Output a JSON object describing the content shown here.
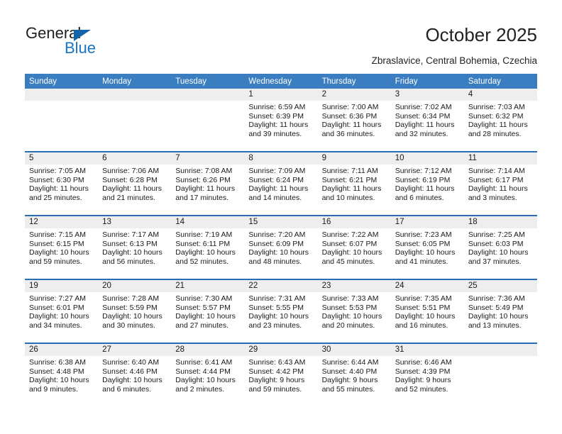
{
  "brand": {
    "name_top": "General",
    "name_bottom": "Blue",
    "accent_color": "#1874c4"
  },
  "header": {
    "title": "October 2025",
    "subtitle": "Zbraslavice, Central Bohemia, Czechia"
  },
  "colors": {
    "header_row_bg": "#3a7dc0",
    "header_row_text": "#ffffff",
    "row_divider": "#2a6db5",
    "date_strip_bg": "#eeeeee"
  },
  "labels": {
    "sunrise_prefix": "Sunrise:",
    "sunset_prefix": "Sunset:",
    "daylight_prefix": "Daylight:"
  },
  "weekdays": [
    "Sunday",
    "Monday",
    "Tuesday",
    "Wednesday",
    "Thursday",
    "Friday",
    "Saturday"
  ],
  "weeks": [
    [
      {
        "day": "",
        "sunrise": "",
        "sunset": "",
        "daylight": "",
        "empty": true
      },
      {
        "day": "",
        "sunrise": "",
        "sunset": "",
        "daylight": "",
        "empty": true
      },
      {
        "day": "",
        "sunrise": "",
        "sunset": "",
        "daylight": "",
        "empty": true
      },
      {
        "day": "1",
        "sunrise": "Sunrise: 6:59 AM",
        "sunset": "Sunset: 6:39 PM",
        "daylight": "Daylight: 11 hours and 39 minutes."
      },
      {
        "day": "2",
        "sunrise": "Sunrise: 7:00 AM",
        "sunset": "Sunset: 6:36 PM",
        "daylight": "Daylight: 11 hours and 36 minutes."
      },
      {
        "day": "3",
        "sunrise": "Sunrise: 7:02 AM",
        "sunset": "Sunset: 6:34 PM",
        "daylight": "Daylight: 11 hours and 32 minutes."
      },
      {
        "day": "4",
        "sunrise": "Sunrise: 7:03 AM",
        "sunset": "Sunset: 6:32 PM",
        "daylight": "Daylight: 11 hours and 28 minutes."
      }
    ],
    [
      {
        "day": "5",
        "sunrise": "Sunrise: 7:05 AM",
        "sunset": "Sunset: 6:30 PM",
        "daylight": "Daylight: 11 hours and 25 minutes."
      },
      {
        "day": "6",
        "sunrise": "Sunrise: 7:06 AM",
        "sunset": "Sunset: 6:28 PM",
        "daylight": "Daylight: 11 hours and 21 minutes."
      },
      {
        "day": "7",
        "sunrise": "Sunrise: 7:08 AM",
        "sunset": "Sunset: 6:26 PM",
        "daylight": "Daylight: 11 hours and 17 minutes."
      },
      {
        "day": "8",
        "sunrise": "Sunrise: 7:09 AM",
        "sunset": "Sunset: 6:24 PM",
        "daylight": "Daylight: 11 hours and 14 minutes."
      },
      {
        "day": "9",
        "sunrise": "Sunrise: 7:11 AM",
        "sunset": "Sunset: 6:21 PM",
        "daylight": "Daylight: 11 hours and 10 minutes."
      },
      {
        "day": "10",
        "sunrise": "Sunrise: 7:12 AM",
        "sunset": "Sunset: 6:19 PM",
        "daylight": "Daylight: 11 hours and 6 minutes."
      },
      {
        "day": "11",
        "sunrise": "Sunrise: 7:14 AM",
        "sunset": "Sunset: 6:17 PM",
        "daylight": "Daylight: 11 hours and 3 minutes."
      }
    ],
    [
      {
        "day": "12",
        "sunrise": "Sunrise: 7:15 AM",
        "sunset": "Sunset: 6:15 PM",
        "daylight": "Daylight: 10 hours and 59 minutes."
      },
      {
        "day": "13",
        "sunrise": "Sunrise: 7:17 AM",
        "sunset": "Sunset: 6:13 PM",
        "daylight": "Daylight: 10 hours and 56 minutes."
      },
      {
        "day": "14",
        "sunrise": "Sunrise: 7:19 AM",
        "sunset": "Sunset: 6:11 PM",
        "daylight": "Daylight: 10 hours and 52 minutes."
      },
      {
        "day": "15",
        "sunrise": "Sunrise: 7:20 AM",
        "sunset": "Sunset: 6:09 PM",
        "daylight": "Daylight: 10 hours and 48 minutes."
      },
      {
        "day": "16",
        "sunrise": "Sunrise: 7:22 AM",
        "sunset": "Sunset: 6:07 PM",
        "daylight": "Daylight: 10 hours and 45 minutes."
      },
      {
        "day": "17",
        "sunrise": "Sunrise: 7:23 AM",
        "sunset": "Sunset: 6:05 PM",
        "daylight": "Daylight: 10 hours and 41 minutes."
      },
      {
        "day": "18",
        "sunrise": "Sunrise: 7:25 AM",
        "sunset": "Sunset: 6:03 PM",
        "daylight": "Daylight: 10 hours and 37 minutes."
      }
    ],
    [
      {
        "day": "19",
        "sunrise": "Sunrise: 7:27 AM",
        "sunset": "Sunset: 6:01 PM",
        "daylight": "Daylight: 10 hours and 34 minutes."
      },
      {
        "day": "20",
        "sunrise": "Sunrise: 7:28 AM",
        "sunset": "Sunset: 5:59 PM",
        "daylight": "Daylight: 10 hours and 30 minutes."
      },
      {
        "day": "21",
        "sunrise": "Sunrise: 7:30 AM",
        "sunset": "Sunset: 5:57 PM",
        "daylight": "Daylight: 10 hours and 27 minutes."
      },
      {
        "day": "22",
        "sunrise": "Sunrise: 7:31 AM",
        "sunset": "Sunset: 5:55 PM",
        "daylight": "Daylight: 10 hours and 23 minutes."
      },
      {
        "day": "23",
        "sunrise": "Sunrise: 7:33 AM",
        "sunset": "Sunset: 5:53 PM",
        "daylight": "Daylight: 10 hours and 20 minutes."
      },
      {
        "day": "24",
        "sunrise": "Sunrise: 7:35 AM",
        "sunset": "Sunset: 5:51 PM",
        "daylight": "Daylight: 10 hours and 16 minutes."
      },
      {
        "day": "25",
        "sunrise": "Sunrise: 7:36 AM",
        "sunset": "Sunset: 5:49 PM",
        "daylight": "Daylight: 10 hours and 13 minutes."
      }
    ],
    [
      {
        "day": "26",
        "sunrise": "Sunrise: 6:38 AM",
        "sunset": "Sunset: 4:48 PM",
        "daylight": "Daylight: 10 hours and 9 minutes."
      },
      {
        "day": "27",
        "sunrise": "Sunrise: 6:40 AM",
        "sunset": "Sunset: 4:46 PM",
        "daylight": "Daylight: 10 hours and 6 minutes."
      },
      {
        "day": "28",
        "sunrise": "Sunrise: 6:41 AM",
        "sunset": "Sunset: 4:44 PM",
        "daylight": "Daylight: 10 hours and 2 minutes."
      },
      {
        "day": "29",
        "sunrise": "Sunrise: 6:43 AM",
        "sunset": "Sunset: 4:42 PM",
        "daylight": "Daylight: 9 hours and 59 minutes."
      },
      {
        "day": "30",
        "sunrise": "Sunrise: 6:44 AM",
        "sunset": "Sunset: 4:40 PM",
        "daylight": "Daylight: 9 hours and 55 minutes."
      },
      {
        "day": "31",
        "sunrise": "Sunrise: 6:46 AM",
        "sunset": "Sunset: 4:39 PM",
        "daylight": "Daylight: 9 hours and 52 minutes."
      },
      {
        "day": "",
        "sunrise": "",
        "sunset": "",
        "daylight": "",
        "empty": true
      }
    ]
  ]
}
